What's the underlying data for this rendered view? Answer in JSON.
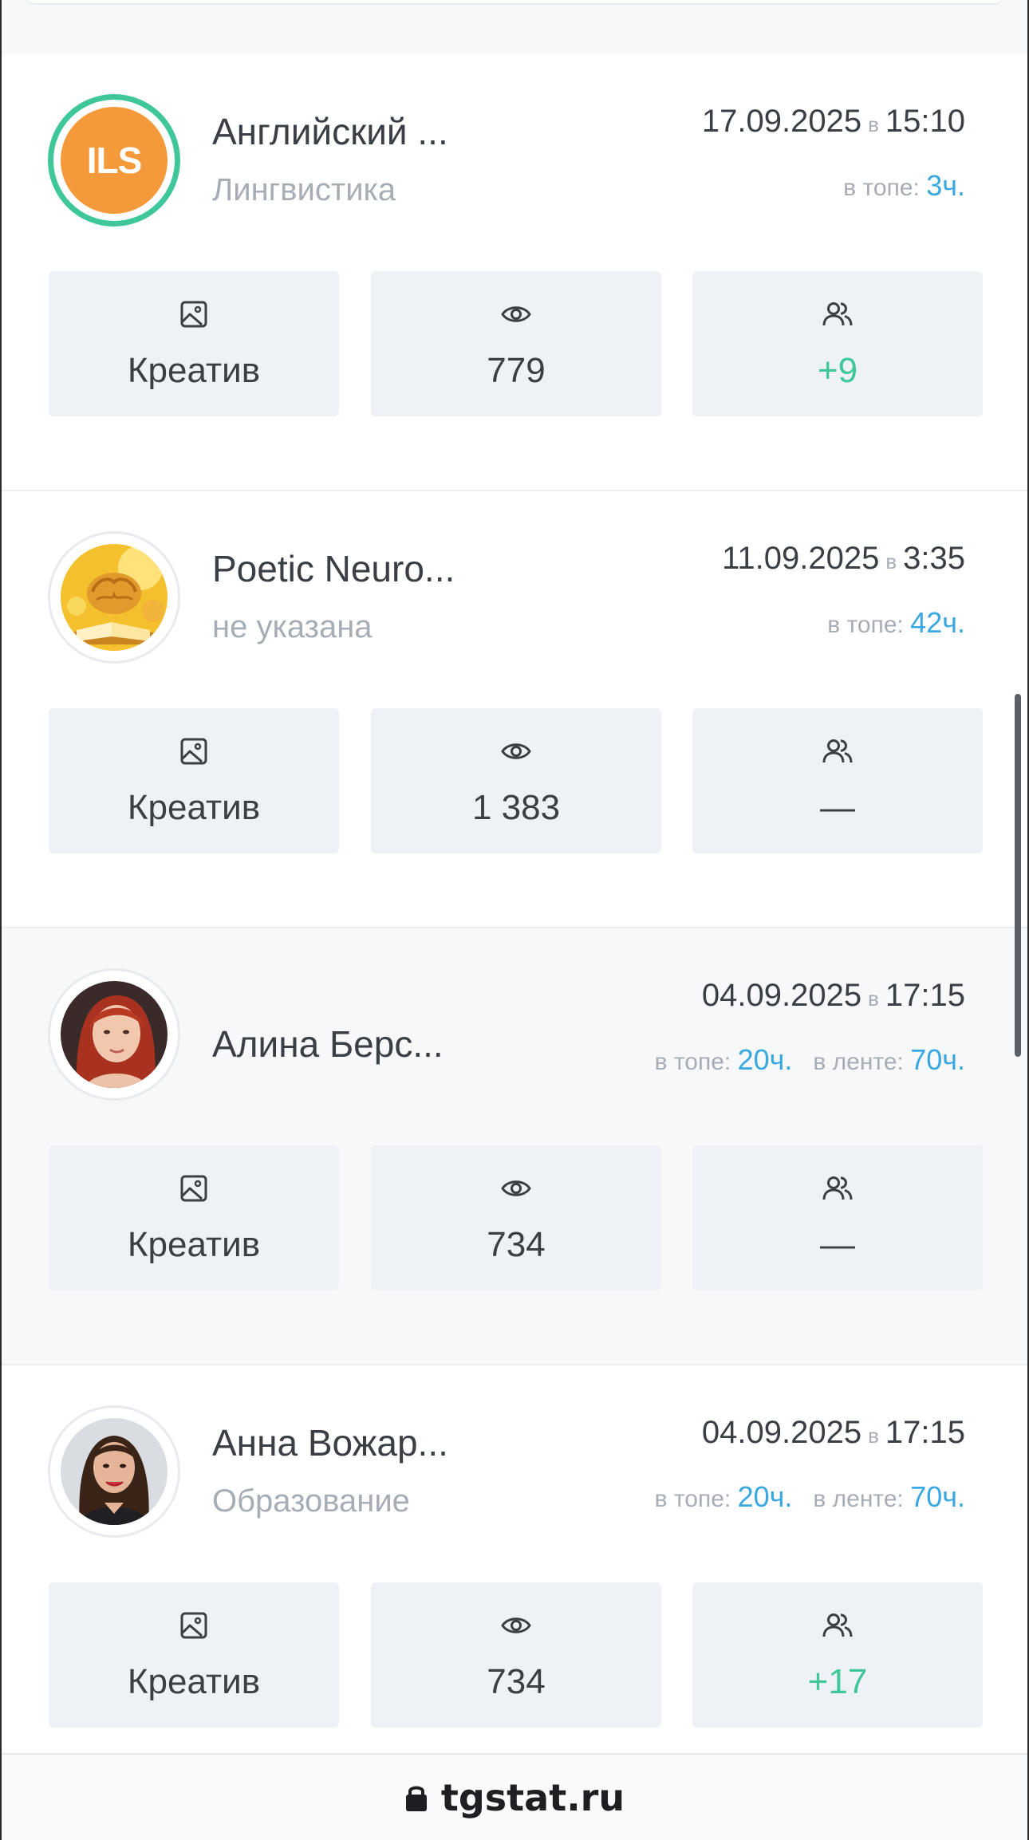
{
  "posts": [
    {
      "avatar_text": "ILS",
      "title": "Английский ...",
      "subtitle": "Лингвистика",
      "date": "17.09.2025",
      "at": "в",
      "time": "15:10",
      "top_label": "в топе:",
      "top_value": "3ч.",
      "feed_label": "",
      "feed_value": "",
      "stats": {
        "creative": "Креатив",
        "views": "779",
        "subscribers": "+9"
      }
    },
    {
      "title": "Poetic Neuro...",
      "subtitle": "не указана",
      "date": "11.09.2025",
      "at": "в",
      "time": "3:35",
      "top_label": "в топе:",
      "top_value": "42ч.",
      "feed_label": "",
      "feed_value": "",
      "stats": {
        "creative": "Креатив",
        "views": "1 383",
        "subscribers": "—"
      }
    },
    {
      "title": "Алина Берс...",
      "subtitle": "",
      "date": "04.09.2025",
      "at": "в",
      "time": "17:15",
      "top_label": "в топе:",
      "top_value": "20ч.",
      "feed_label": "в ленте:",
      "feed_value": "70ч.",
      "stats": {
        "creative": "Креатив",
        "views": "734",
        "subscribers": "—"
      }
    },
    {
      "title": "Анна Вожар...",
      "subtitle": "Образование",
      "date": "04.09.2025",
      "at": "в",
      "time": "17:15",
      "top_label": "в топе:",
      "top_value": "20ч.",
      "feed_label": "в ленте:",
      "feed_value": "70ч.",
      "stats": {
        "creative": "Креатив",
        "views": "734",
        "subscribers": "+17"
      }
    }
  ],
  "footer": {
    "domain": "tgstat.ru",
    "icon": "lock-icon"
  },
  "colors": {
    "accent_green": "#3fc79a",
    "accent_blue": "#3aa8e0",
    "ils_orange": "#f59a3a",
    "stat_bg": "#eef1f6"
  }
}
